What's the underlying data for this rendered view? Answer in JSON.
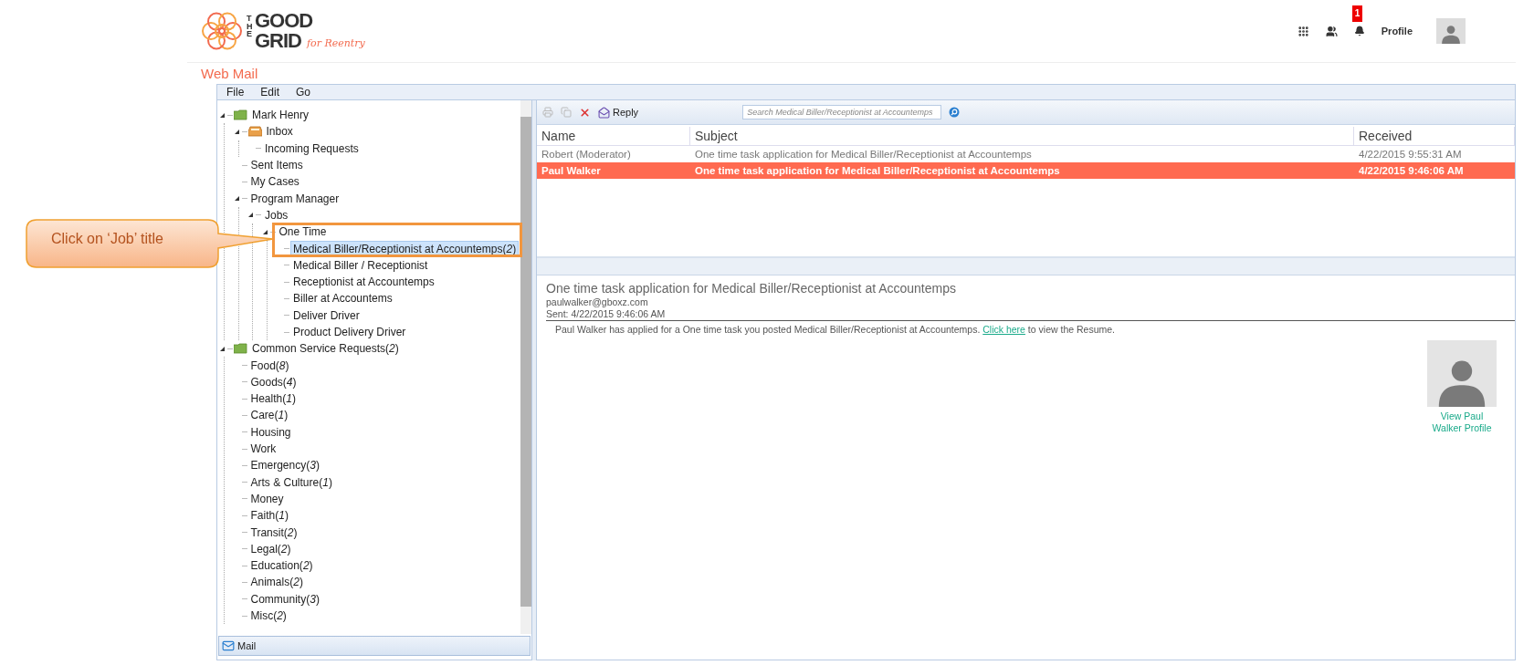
{
  "header": {
    "logo": {
      "the": "THE",
      "good": "GOOD",
      "grid": "GRID",
      "tagline": "for Reentry"
    },
    "notification_count": "1",
    "profile_label": "Profile"
  },
  "app_title": "Web Mail",
  "menu": [
    "File",
    "Edit",
    "Go"
  ],
  "tree": [
    {
      "label": "Mark Henry",
      "kind": "folder",
      "expanded": true,
      "selected": false,
      "children": [
        {
          "label": "Inbox",
          "kind": "inbox",
          "expanded": true,
          "selected": false,
          "children": [
            {
              "label": "Incoming Requests",
              "selected": false
            }
          ]
        },
        {
          "label": "Sent Items",
          "selected": false
        },
        {
          "label": "My Cases",
          "selected": false
        },
        {
          "label": "Program Manager",
          "expanded": true,
          "selected": false,
          "children": [
            {
              "label": "Jobs",
              "expanded": true,
              "selected": false,
              "children": [
                {
                  "label": "One Time",
                  "expanded": true,
                  "selected": false,
                  "children": [
                    {
                      "label": "Medical Biller/Receptionist at Accountemps(*2*)",
                      "selected": true
                    },
                    {
                      "label": "Medical Biller / Receptionist",
                      "selected": false
                    },
                    {
                      "label": "Receptionist at Accountemps",
                      "selected": false
                    },
                    {
                      "label": "Biller at Accountems",
                      "selected": false
                    },
                    {
                      "label": "Deliver Driver",
                      "selected": false
                    },
                    {
                      "label": "Product Delivery Driver",
                      "selected": false
                    }
                  ]
                }
              ]
            }
          ]
        }
      ]
    },
    {
      "label": "Common Service Requests(*2*)",
      "kind": "folder",
      "expanded": true,
      "selected": false,
      "children": [
        {
          "label": "Food(*8*)",
          "selected": false
        },
        {
          "label": "Goods(*4*)",
          "selected": false
        },
        {
          "label": "Health(*1*)",
          "selected": false
        },
        {
          "label": "Care(*1*)",
          "selected": false
        },
        {
          "label": "Housing",
          "selected": false
        },
        {
          "label": "Work",
          "selected": false
        },
        {
          "label": "Emergency(*3*)",
          "selected": false
        },
        {
          "label": "Arts & Culture(*1*)",
          "selected": false
        },
        {
          "label": "Money",
          "selected": false
        },
        {
          "label": "Faith(*1*)",
          "selected": false
        },
        {
          "label": "Transit(*2*)",
          "selected": false
        },
        {
          "label": "Legal(*2*)",
          "selected": false
        },
        {
          "label": "Education(*2*)",
          "selected": false
        },
        {
          "label": "Animals(*2*)",
          "selected": false
        },
        {
          "label": "Community(*3*)",
          "selected": false
        },
        {
          "label": "Misc(*2*)",
          "selected": false
        }
      ]
    }
  ],
  "nav_button": {
    "label": "Mail"
  },
  "toolbar": {
    "reply_label": "Reply",
    "search": {
      "placeholder": "Search Medical Biller/Receptionist at Accountemps"
    }
  },
  "message_list": {
    "columns": [
      "Name",
      "Subject",
      "Received"
    ],
    "rows": [
      {
        "cells": [
          "Robert (Moderator)",
          "One time task application for Medical Biller/Receptionist at Accountemps",
          "4/22/2015 9:55:31 AM"
        ],
        "selected": false
      },
      {
        "cells": [
          "Paul Walker",
          "One time task application for Medical Biller/Receptionist at Accountemps",
          "4/22/2015 9:46:06 AM"
        ],
        "selected": true
      }
    ]
  },
  "preview": {
    "subject": "One time task application for Medical Biller/Receptionist at Accountemps",
    "from": "paulwalker@gboxz.com",
    "sent": "Sent: 4/22/2015 9:46:06 AM",
    "body": {
      "before": "Paul Walker has applied for a One time task you posted Medical Biller/Receptionist at Accountemps. ",
      "link": "Click here",
      "after": " to view the Resume."
    },
    "profile_link": "View Paul Walker Profile"
  },
  "callout": {
    "text": "Click on ‘Job’ title"
  }
}
